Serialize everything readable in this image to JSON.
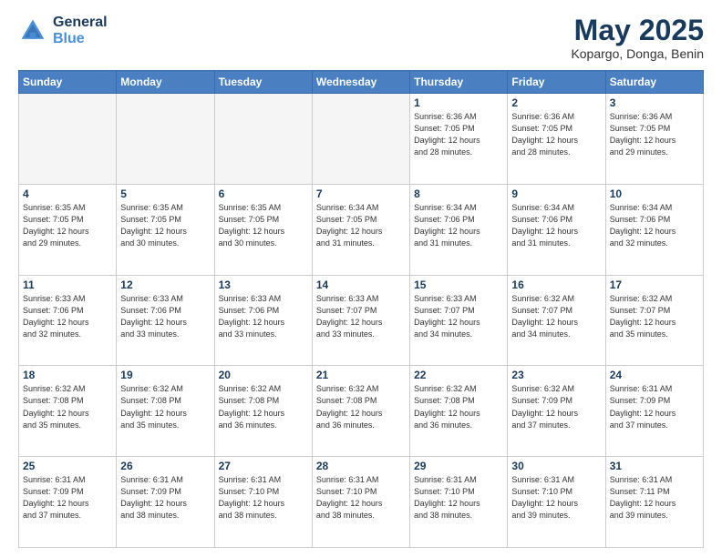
{
  "header": {
    "logo_general": "General",
    "logo_blue": "Blue",
    "month_title": "May 2025",
    "location": "Kopargo, Donga, Benin"
  },
  "days_of_week": [
    "Sunday",
    "Monday",
    "Tuesday",
    "Wednesday",
    "Thursday",
    "Friday",
    "Saturday"
  ],
  "weeks": [
    [
      {
        "day": "",
        "info": ""
      },
      {
        "day": "",
        "info": ""
      },
      {
        "day": "",
        "info": ""
      },
      {
        "day": "",
        "info": ""
      },
      {
        "day": "1",
        "info": "Sunrise: 6:36 AM\nSunset: 7:05 PM\nDaylight: 12 hours\nand 28 minutes."
      },
      {
        "day": "2",
        "info": "Sunrise: 6:36 AM\nSunset: 7:05 PM\nDaylight: 12 hours\nand 28 minutes."
      },
      {
        "day": "3",
        "info": "Sunrise: 6:36 AM\nSunset: 7:05 PM\nDaylight: 12 hours\nand 29 minutes."
      }
    ],
    [
      {
        "day": "4",
        "info": "Sunrise: 6:35 AM\nSunset: 7:05 PM\nDaylight: 12 hours\nand 29 minutes."
      },
      {
        "day": "5",
        "info": "Sunrise: 6:35 AM\nSunset: 7:05 PM\nDaylight: 12 hours\nand 30 minutes."
      },
      {
        "day": "6",
        "info": "Sunrise: 6:35 AM\nSunset: 7:05 PM\nDaylight: 12 hours\nand 30 minutes."
      },
      {
        "day": "7",
        "info": "Sunrise: 6:34 AM\nSunset: 7:05 PM\nDaylight: 12 hours\nand 31 minutes."
      },
      {
        "day": "8",
        "info": "Sunrise: 6:34 AM\nSunset: 7:06 PM\nDaylight: 12 hours\nand 31 minutes."
      },
      {
        "day": "9",
        "info": "Sunrise: 6:34 AM\nSunset: 7:06 PM\nDaylight: 12 hours\nand 31 minutes."
      },
      {
        "day": "10",
        "info": "Sunrise: 6:34 AM\nSunset: 7:06 PM\nDaylight: 12 hours\nand 32 minutes."
      }
    ],
    [
      {
        "day": "11",
        "info": "Sunrise: 6:33 AM\nSunset: 7:06 PM\nDaylight: 12 hours\nand 32 minutes."
      },
      {
        "day": "12",
        "info": "Sunrise: 6:33 AM\nSunset: 7:06 PM\nDaylight: 12 hours\nand 33 minutes."
      },
      {
        "day": "13",
        "info": "Sunrise: 6:33 AM\nSunset: 7:06 PM\nDaylight: 12 hours\nand 33 minutes."
      },
      {
        "day": "14",
        "info": "Sunrise: 6:33 AM\nSunset: 7:07 PM\nDaylight: 12 hours\nand 33 minutes."
      },
      {
        "day": "15",
        "info": "Sunrise: 6:33 AM\nSunset: 7:07 PM\nDaylight: 12 hours\nand 34 minutes."
      },
      {
        "day": "16",
        "info": "Sunrise: 6:32 AM\nSunset: 7:07 PM\nDaylight: 12 hours\nand 34 minutes."
      },
      {
        "day": "17",
        "info": "Sunrise: 6:32 AM\nSunset: 7:07 PM\nDaylight: 12 hours\nand 35 minutes."
      }
    ],
    [
      {
        "day": "18",
        "info": "Sunrise: 6:32 AM\nSunset: 7:08 PM\nDaylight: 12 hours\nand 35 minutes."
      },
      {
        "day": "19",
        "info": "Sunrise: 6:32 AM\nSunset: 7:08 PM\nDaylight: 12 hours\nand 35 minutes."
      },
      {
        "day": "20",
        "info": "Sunrise: 6:32 AM\nSunset: 7:08 PM\nDaylight: 12 hours\nand 36 minutes."
      },
      {
        "day": "21",
        "info": "Sunrise: 6:32 AM\nSunset: 7:08 PM\nDaylight: 12 hours\nand 36 minutes."
      },
      {
        "day": "22",
        "info": "Sunrise: 6:32 AM\nSunset: 7:08 PM\nDaylight: 12 hours\nand 36 minutes."
      },
      {
        "day": "23",
        "info": "Sunrise: 6:32 AM\nSunset: 7:09 PM\nDaylight: 12 hours\nand 37 minutes."
      },
      {
        "day": "24",
        "info": "Sunrise: 6:31 AM\nSunset: 7:09 PM\nDaylight: 12 hours\nand 37 minutes."
      }
    ],
    [
      {
        "day": "25",
        "info": "Sunrise: 6:31 AM\nSunset: 7:09 PM\nDaylight: 12 hours\nand 37 minutes."
      },
      {
        "day": "26",
        "info": "Sunrise: 6:31 AM\nSunset: 7:09 PM\nDaylight: 12 hours\nand 38 minutes."
      },
      {
        "day": "27",
        "info": "Sunrise: 6:31 AM\nSunset: 7:10 PM\nDaylight: 12 hours\nand 38 minutes."
      },
      {
        "day": "28",
        "info": "Sunrise: 6:31 AM\nSunset: 7:10 PM\nDaylight: 12 hours\nand 38 minutes."
      },
      {
        "day": "29",
        "info": "Sunrise: 6:31 AM\nSunset: 7:10 PM\nDaylight: 12 hours\nand 38 minutes."
      },
      {
        "day": "30",
        "info": "Sunrise: 6:31 AM\nSunset: 7:10 PM\nDaylight: 12 hours\nand 39 minutes."
      },
      {
        "day": "31",
        "info": "Sunrise: 6:31 AM\nSunset: 7:11 PM\nDaylight: 12 hours\nand 39 minutes."
      }
    ]
  ]
}
